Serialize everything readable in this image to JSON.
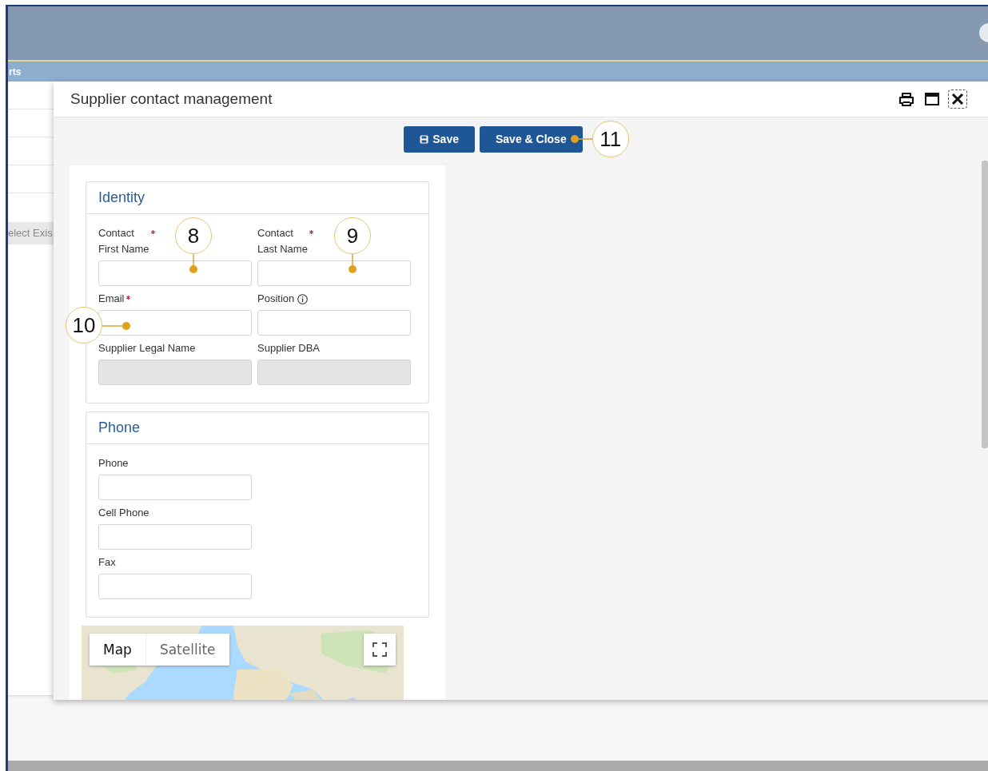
{
  "app": {
    "nav_text": "rts",
    "background_field": "elect Exis"
  },
  "dialog": {
    "title": "Supplier contact management",
    "toolbar": [
      {
        "label": "Save"
      },
      {
        "label": "Save & Close",
        "callout": "11"
      }
    ],
    "sections": [
      {
        "title": "Identity",
        "fields": [
          {
            "label": [
              "Contact",
              "First Name"
            ],
            "required": true,
            "info": false,
            "disabled": false,
            "callout": "8"
          },
          {
            "label": [
              "Contact",
              "Last Name"
            ],
            "required": true,
            "info": false,
            "disabled": false,
            "callout": "9"
          },
          {
            "label": [
              "Email"
            ],
            "required": true,
            "info": false,
            "disabled": false,
            "callout": "10"
          },
          {
            "label": [
              "Position"
            ],
            "required": false,
            "info": true,
            "disabled": false
          },
          {
            "label": [
              "Supplier Legal Name"
            ],
            "required": false,
            "info": false,
            "disabled": true
          },
          {
            "label": [
              "Supplier DBA"
            ],
            "required": false,
            "info": false,
            "disabled": true
          }
        ]
      },
      {
        "title": "Phone",
        "fields": [
          {
            "label": [
              "Phone"
            ],
            "required": false,
            "info": false,
            "disabled": false
          },
          {
            "label": [
              "Cell Phone"
            ],
            "required": false,
            "info": false,
            "disabled": false
          },
          {
            "label": [
              "Fax"
            ],
            "required": false,
            "info": false,
            "disabled": false
          }
        ]
      }
    ],
    "map": {
      "kind": "picture",
      "map_types": [
        {
          "label": "Map",
          "selected": true
        },
        {
          "label": "Satellite",
          "selected": false
        }
      ]
    }
  }
}
